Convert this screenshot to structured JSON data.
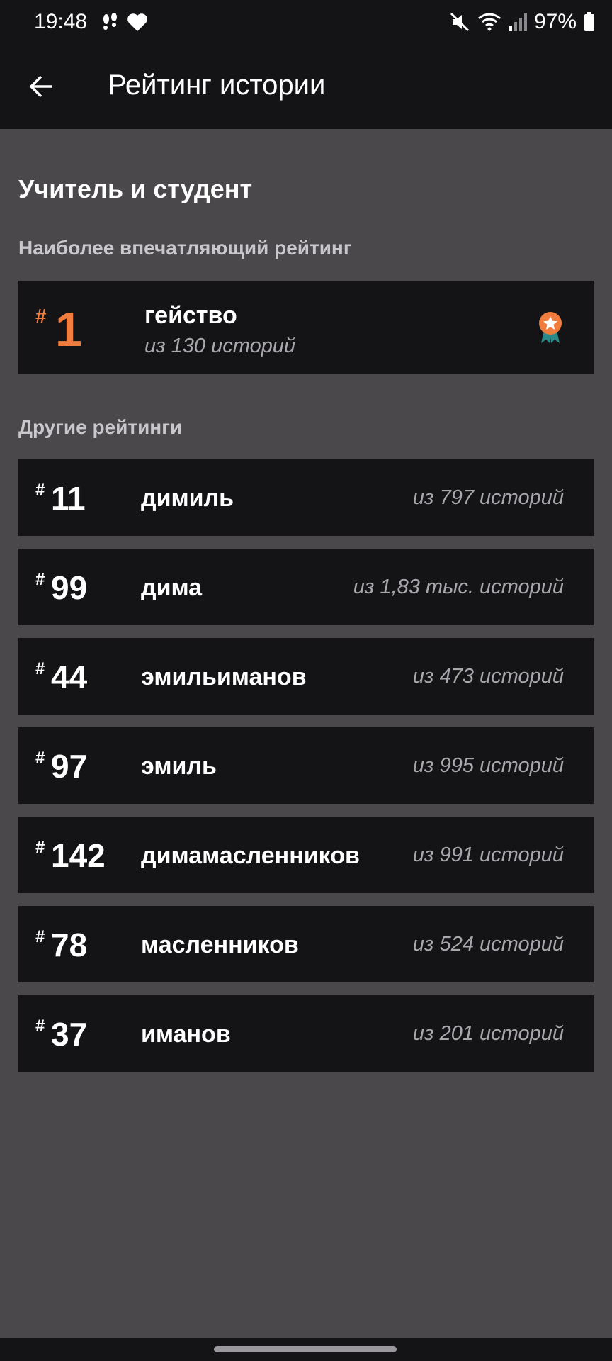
{
  "status_bar": {
    "time": "19:48",
    "battery": "97%",
    "icons": [
      "footsteps-icon",
      "heart-icon",
      "mute-icon",
      "wifi-icon",
      "signal-icon",
      "battery-icon"
    ]
  },
  "app_bar": {
    "title": "Рейтинг истории",
    "back_icon": "arrow-left-icon"
  },
  "story": {
    "title": "Учитель и студент"
  },
  "top_section": {
    "label": "Наиболее впечатляющий рейтинг",
    "item": {
      "hash": "#",
      "rank": "1",
      "name": "гейство",
      "count": "из 130 историй",
      "badge_icon": "award-ribbon-icon",
      "accent_color": "#f07d3e",
      "badge_ribbon_color": "#2a8a8a"
    }
  },
  "other_section": {
    "label": "Другие рейтинги",
    "items": [
      {
        "hash": "#",
        "rank": "11",
        "name": "димиль",
        "count": "из 797 историй"
      },
      {
        "hash": "#",
        "rank": "99",
        "name": "дима",
        "count": "из 1,83 тыс. историй"
      },
      {
        "hash": "#",
        "rank": "44",
        "name": "эмильиманов",
        "count": "из 473 историй"
      },
      {
        "hash": "#",
        "rank": "97",
        "name": "эмиль",
        "count": "из 995 историй"
      },
      {
        "hash": "#",
        "rank": "142",
        "name": "димамасленников",
        "count": "из 991 историй"
      },
      {
        "hash": "#",
        "rank": "78",
        "name": "масленников",
        "count": "из 524 историй"
      },
      {
        "hash": "#",
        "rank": "37",
        "name": "иманов",
        "count": "из 201 историй"
      }
    ]
  }
}
